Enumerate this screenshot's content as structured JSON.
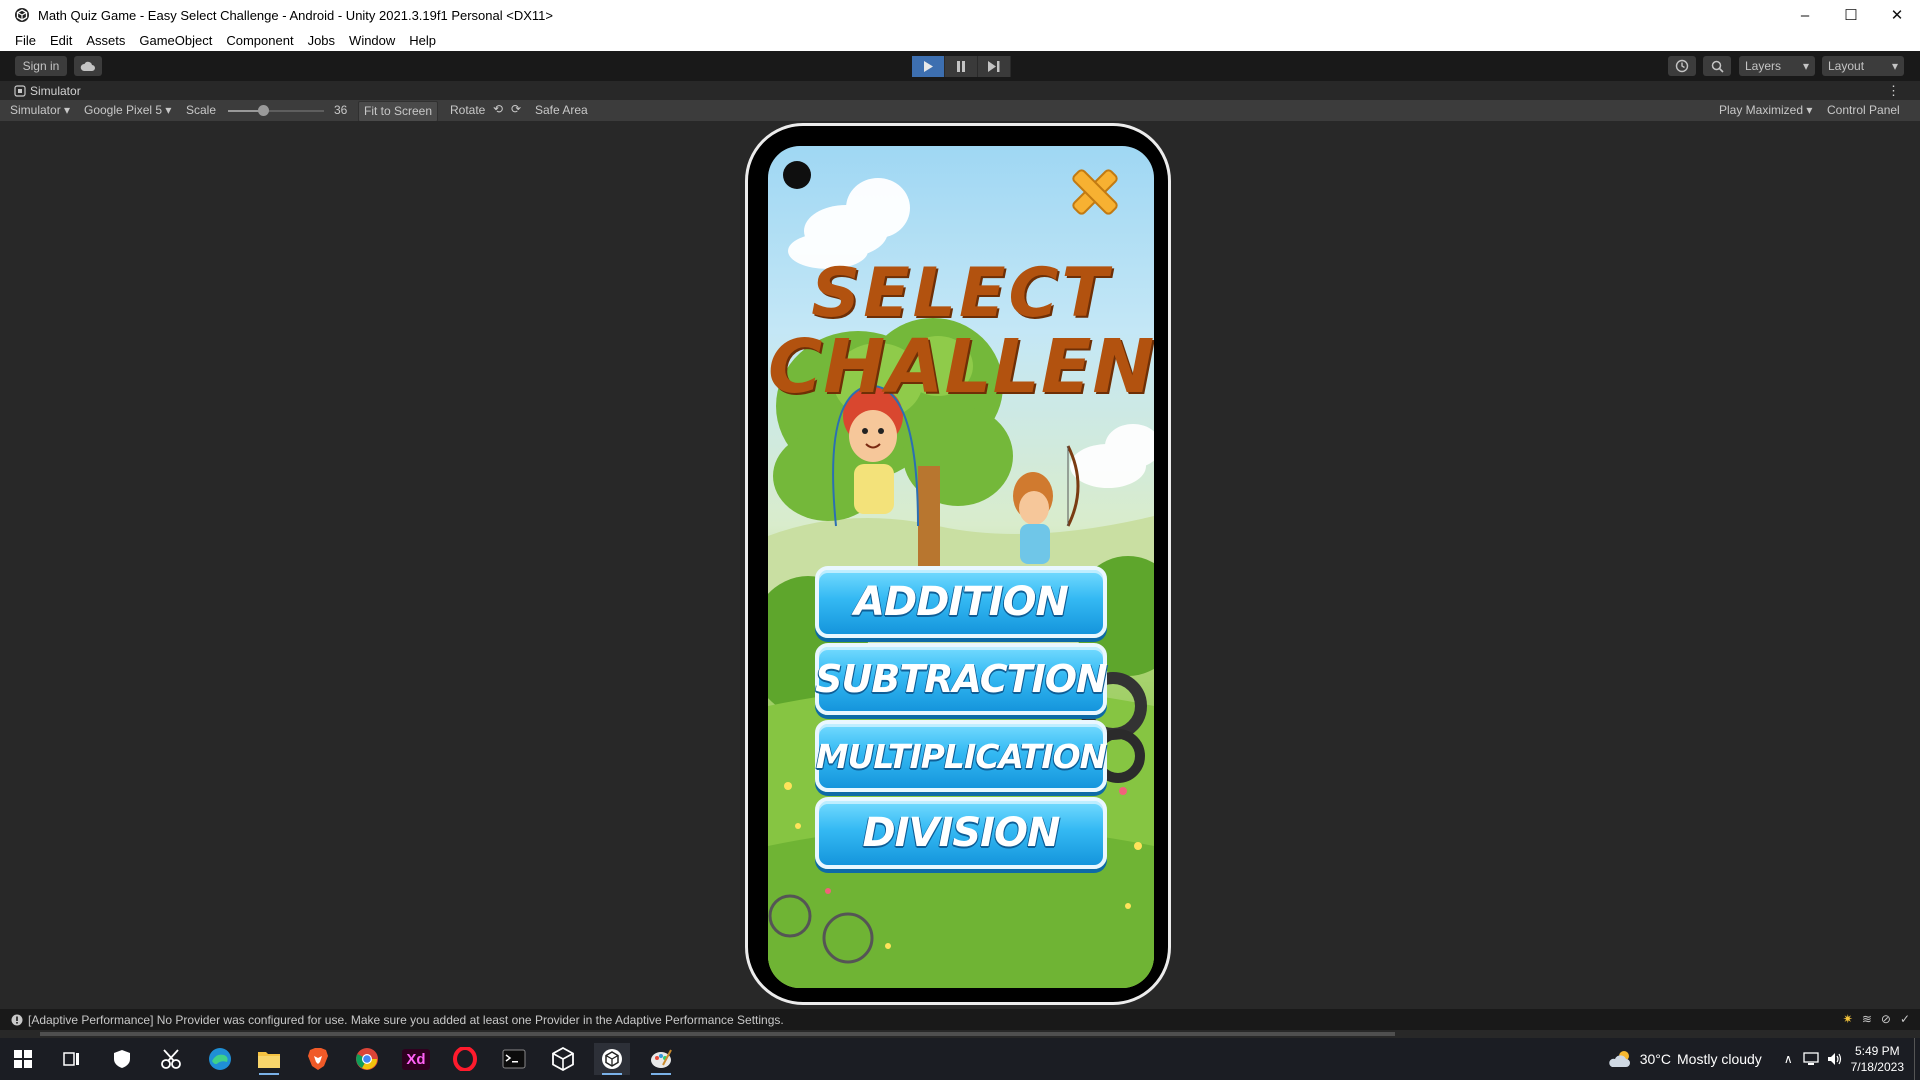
{
  "window": {
    "title": "Math Quiz Game - Easy Select Challenge - Android - Unity 2021.3.19f1 Personal <DX11>",
    "controls": {
      "minimize": "–",
      "maximize": "☐",
      "close": "✕"
    }
  },
  "menu": [
    "File",
    "Edit",
    "Assets",
    "GameObject",
    "Component",
    "Jobs",
    "Window",
    "Help"
  ],
  "toolbar": {
    "sign_in": "Sign in",
    "layers": "Layers",
    "layout": "Layout",
    "play_state": "playing"
  },
  "simulator": {
    "tab_label": "Simulator",
    "mode": "Simulator",
    "device": "Google Pixel 5",
    "scale_label": "Scale",
    "scale_value": "36",
    "fit_to_screen": "Fit to Screen",
    "rotate": "Rotate",
    "safe_area": "Safe Area",
    "play_maximized": "Play Maximized",
    "control_panel": "Control Panel"
  },
  "game": {
    "title_line1": "SELECT",
    "title_line2": "CHALLENGE",
    "buttons": [
      {
        "label": "ADDITION"
      },
      {
        "label": "SUBTRACTION"
      },
      {
        "label": "MULTIPLICATION"
      },
      {
        "label": "DIVISION"
      }
    ]
  },
  "console": {
    "message": "[Adaptive Performance] No Provider was configured for use. Make sure you added at least one Provider in the Adaptive Performance Settings."
  },
  "taskbar": {
    "apps": [
      "windows-start",
      "task-view",
      "security",
      "snipping",
      "edge",
      "file-explorer",
      "brave",
      "chrome",
      "adobe-xd",
      "opera",
      "terminal",
      "unity-hub",
      "unity-editor",
      "paint"
    ],
    "xd_label": "Xd",
    "weather_temp": "30°C",
    "weather_text": "Mostly cloudy",
    "time": "5:49 PM",
    "date": "7/18/2023"
  },
  "colors": {
    "title_brown": "#b2520f",
    "button_blue": "#34b9f3",
    "play_active": "#3d6fb0"
  }
}
